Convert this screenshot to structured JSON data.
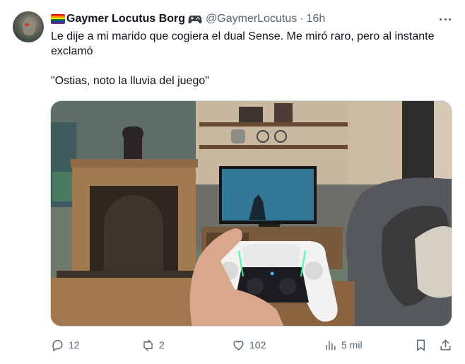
{
  "tweet": {
    "author": {
      "display_name": "Gaymer Locutus Borg",
      "handle": "@GaymerLocutus",
      "separator": "·",
      "time": "16h",
      "flag_colors": [
        "#e40303",
        "#ff8c00",
        "#ffed00",
        "#008026",
        "#24408e",
        "#732982"
      ]
    },
    "text": {
      "line1": "Le dije a mi marido que cogiera el dual Sense. Me miró raro, pero al instante exclamó",
      "line2": "\"Ostias, noto la lluvia del juego\""
    },
    "actions": {
      "replies": "12",
      "reposts": "2",
      "likes": "102",
      "views": "5 mil"
    },
    "icons": [
      "reply-icon",
      "repost-icon",
      "like-icon",
      "views-icon",
      "bookmark-icon",
      "share-icon",
      "more-icon"
    ]
  }
}
